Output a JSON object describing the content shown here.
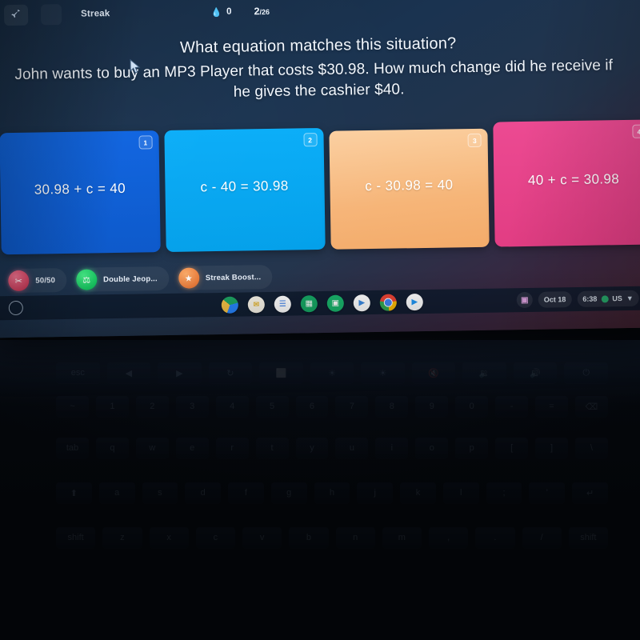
{
  "topbar": {
    "logo_icon": "rocket-icon",
    "streak_label": "Streak",
    "streak_flame_icon": "flame-icon",
    "streak_value": "0",
    "question_counter_current": "2",
    "question_counter_total": "/26"
  },
  "question": {
    "title": "What equation matches this situation?",
    "line2": "John wants to buy an MP3 Player that costs $30.98. How much change did he receive if",
    "line3": "he gives the cashier $40."
  },
  "answers": [
    {
      "number": "1",
      "text": "30.98 + c = 40",
      "color": "#0b5fdc"
    },
    {
      "number": "2",
      "text": "c - 40 = 30.98",
      "color": "#06a6f5"
    },
    {
      "number": "3",
      "text": "c - 30.98 = 40",
      "color": "#f8c28c"
    },
    {
      "number": "4",
      "text": "40 + c = 30.98",
      "color": "#e8458c"
    }
  ],
  "powerups": [
    {
      "label": "50/50",
      "icon": "scissors-icon"
    },
    {
      "label": "Double Jeop...",
      "icon": "double-jeopardy-icon"
    },
    {
      "label": "Streak Boost...",
      "icon": "streak-boost-icon"
    }
  ],
  "shelf": {
    "launcher_icon": "launcher-circle-icon",
    "apps": [
      {
        "name": "google-drive-icon",
        "glyph": ""
      },
      {
        "name": "gmail-icon",
        "glyph": "M"
      },
      {
        "name": "google-docs-icon",
        "glyph": "≡"
      },
      {
        "name": "google-sheets-icon",
        "glyph": "⊞"
      },
      {
        "name": "google-slides-icon",
        "glyph": "▢"
      },
      {
        "name": "google-meet-icon",
        "glyph": "▶"
      },
      {
        "name": "chrome-icon",
        "glyph": ""
      },
      {
        "name": "play-store-icon",
        "glyph": "▶"
      }
    ],
    "tray": {
      "cast_icon": "cast-icon",
      "date": "Oct 18",
      "time": "6:38",
      "battery_icon": "battery-icon",
      "keyboard_layout": "US",
      "wifi_icon": "wifi-icon"
    }
  },
  "keyboard_rows": [
    [
      "esc",
      "◀",
      "▶",
      "↻",
      "⬜",
      "☀",
      "☀",
      "🔇",
      "🔉",
      "🔊",
      "⏻"
    ],
    [
      "~",
      "1",
      "2",
      "3",
      "4",
      "5",
      "6",
      "7",
      "8",
      "9",
      "0",
      "-",
      "=",
      "⌫"
    ],
    [
      "tab",
      "q",
      "w",
      "e",
      "r",
      "t",
      "y",
      "u",
      "i",
      "o",
      "p",
      "[",
      "]",
      "\\"
    ],
    [
      "⬆",
      "a",
      "s",
      "d",
      "f",
      "g",
      "h",
      "j",
      "k",
      "l",
      ";",
      "'",
      "↵"
    ],
    [
      "shift",
      "z",
      "x",
      "c",
      "v",
      "b",
      "n",
      "m",
      ",",
      ".",
      "/",
      "shift"
    ]
  ]
}
